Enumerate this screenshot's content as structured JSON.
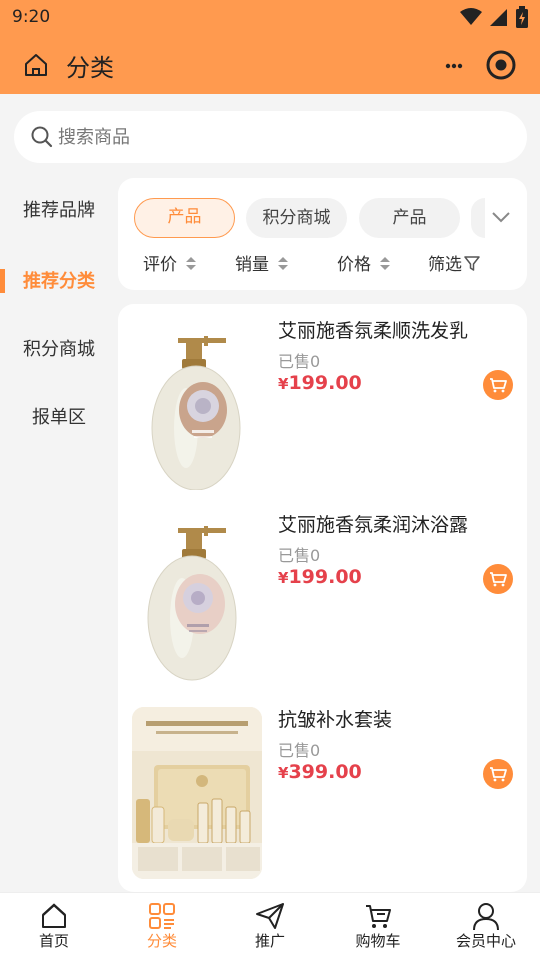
{
  "status_bar": {
    "time": "9:20"
  },
  "header": {
    "title": "分类",
    "home_icon": "home-icon",
    "more_icon": "more-icon",
    "target_icon": "target-icon"
  },
  "search": {
    "placeholder": "搜索商品",
    "value": ""
  },
  "sidebar": {
    "items": [
      {
        "label": "推荐品牌",
        "active": false
      },
      {
        "label": "推荐分类",
        "active": true
      },
      {
        "label": "积分商城",
        "active": false
      },
      {
        "label": "报单区",
        "active": false
      }
    ]
  },
  "filter": {
    "chips": [
      {
        "label": "产品",
        "active": true
      },
      {
        "label": "积分商城",
        "active": false
      },
      {
        "label": "产品",
        "active": false
      }
    ],
    "sort": [
      {
        "label": "评价"
      },
      {
        "label": "销量"
      },
      {
        "label": "价格"
      },
      {
        "label": "筛选"
      }
    ]
  },
  "products": [
    {
      "title": "艾丽施香氛柔顺洗发乳",
      "sold": "已售0",
      "currency": "¥",
      "price": "199.00"
    },
    {
      "title": "艾丽施香氛柔润沐浴露",
      "sold": "已售0",
      "currency": "¥",
      "price": "199.00"
    },
    {
      "title": "抗皱补水套装",
      "sold": "已售0",
      "currency": "¥",
      "price": "399.00"
    }
  ],
  "tab_bar": {
    "items": [
      {
        "label": "首页",
        "active": false,
        "icon": "home-icon"
      },
      {
        "label": "分类",
        "active": true,
        "icon": "category-icon"
      },
      {
        "label": "推广",
        "active": false,
        "icon": "paper-plane-icon"
      },
      {
        "label": "购物车",
        "active": false,
        "icon": "cart-icon"
      },
      {
        "label": "会员中心",
        "active": false,
        "icon": "user-icon"
      }
    ]
  },
  "colors": {
    "accent": "#ff9a4f",
    "active_text": "#ff8c3a",
    "price": "#e5414b"
  }
}
